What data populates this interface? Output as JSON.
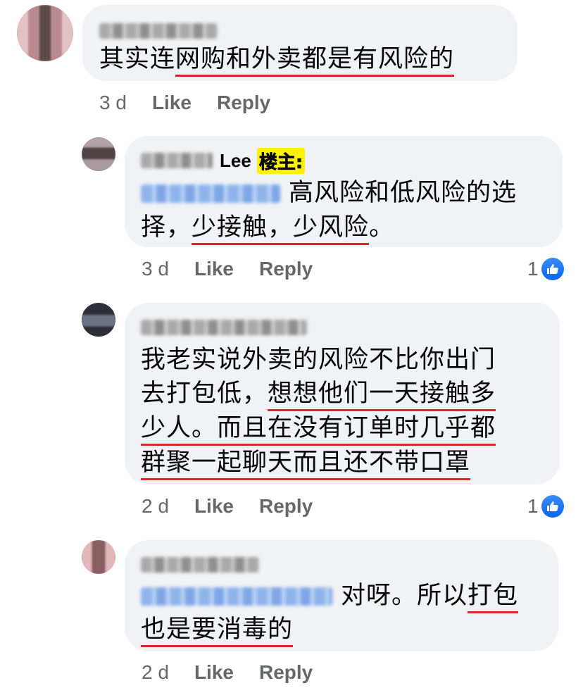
{
  "comments": [
    {
      "text_lines": [
        {
          "plain": "其实连",
          "underlined": "网购和外卖都是有风险的"
        }
      ],
      "time": "3 d",
      "like_label": "Like",
      "reply_label": "Reply",
      "reactions": ""
    },
    {
      "author_suffix": "Lee",
      "badge": "楼主:",
      "text_lines": [
        {
          "after_tag": "高风险和低风险的选"
        },
        {
          "plain": "择，",
          "underlined": "少接触，少风险",
          "tail": "。"
        }
      ],
      "time": "3 d",
      "like_label": "Like",
      "reply_label": "Reply",
      "reactions": "1"
    },
    {
      "text_lines": [
        {
          "plain": "我老实说外卖的风险不比你出门"
        },
        {
          "plain": "去打包低，",
          "underlined": "想想他们一天接触多"
        },
        {
          "underlined": "少人。而且在没有订单时几乎都"
        },
        {
          "underlined": "群聚一起聊天而且还不带口罩"
        }
      ],
      "time": "2 d",
      "like_label": "Like",
      "reply_label": "Reply",
      "reactions": "1"
    },
    {
      "text_lines": [
        {
          "after_tag": "对呀。所以",
          "underlined": "打包"
        },
        {
          "underlined": "也是要消毒的"
        }
      ],
      "time": "2 d",
      "like_label": "Like",
      "reply_label": "Reply",
      "reactions": ""
    }
  ],
  "icons": {
    "like_reaction": "thumbs-up-icon"
  },
  "colors": {
    "bubble": "#f0f2f5",
    "underline": "#e0222c",
    "like_blue": "#1877f2",
    "badge": "#fff200"
  }
}
